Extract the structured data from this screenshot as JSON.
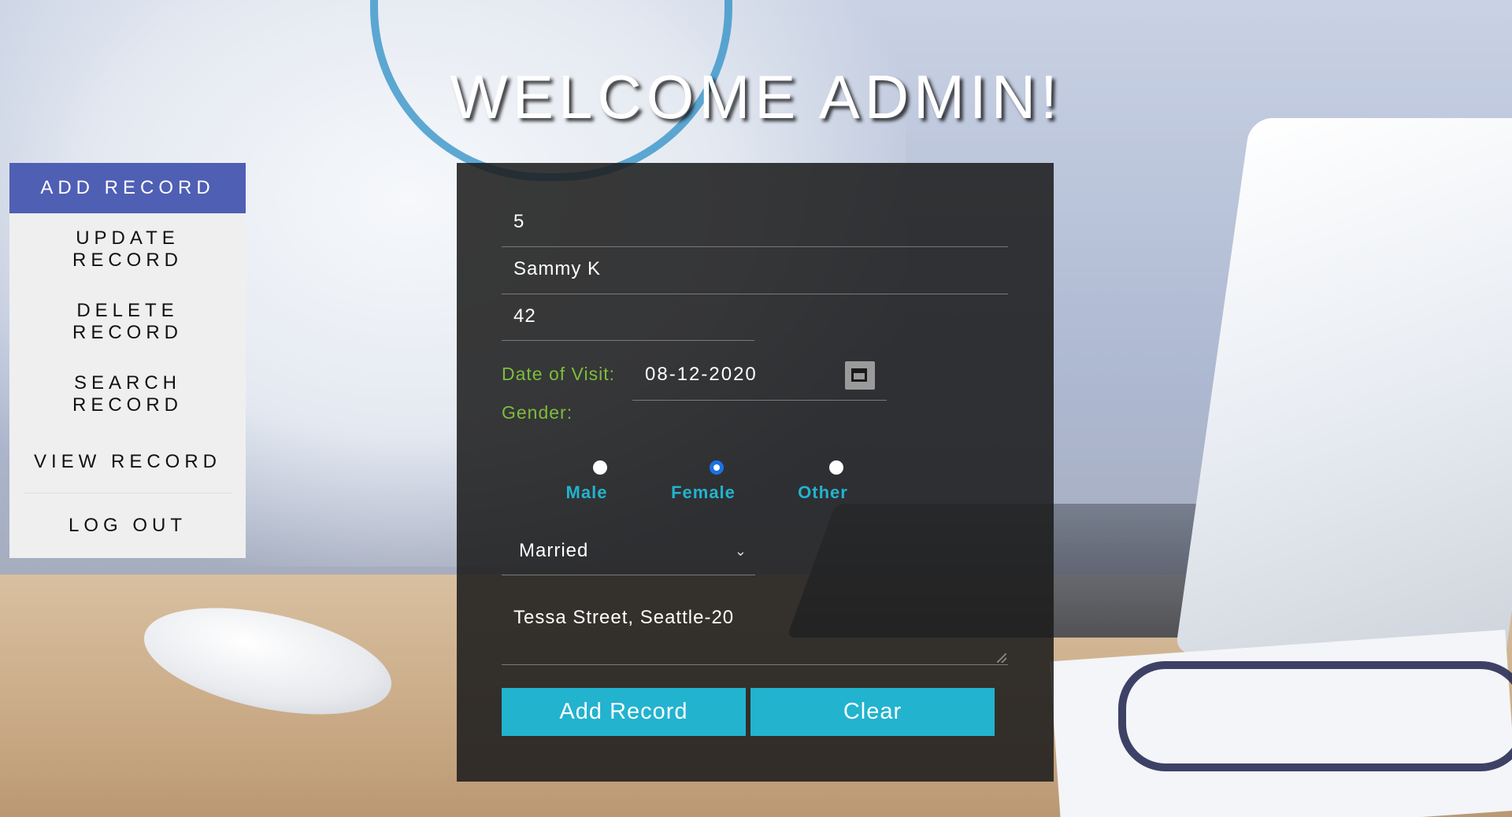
{
  "header": {
    "title": "WELCOME ADMIN!"
  },
  "sidebar": {
    "items": [
      {
        "label": "ADD RECORD",
        "active": true
      },
      {
        "label": "UPDATE RECORD",
        "active": false
      },
      {
        "label": "DELETE RECORD",
        "active": false
      },
      {
        "label": "SEARCH RECORD",
        "active": false
      },
      {
        "label": "VIEW RECORD",
        "active": false
      },
      {
        "label": "LOG OUT",
        "active": false
      }
    ]
  },
  "form": {
    "id_value": "5",
    "name_value": "Sammy K",
    "age_value": "42",
    "date_label": "Date of Visit:",
    "date_value": "08-12-2020",
    "gender_label": "Gender:",
    "gender_options": [
      "Male",
      "Female",
      "Other"
    ],
    "gender_selected": "Female",
    "marital_status_value": "Married",
    "address_value": "Tessa Street, Seattle-20",
    "add_button": "Add Record",
    "clear_button": "Clear"
  },
  "colors": {
    "sidebar_active": "#4f5fb4",
    "button": "#22b3cf",
    "label_green": "#7cbe3a",
    "radio_label": "#22b3cf"
  },
  "icons": {
    "date_picker": "calendar-icon",
    "select_arrow": "chevron-down-icon"
  }
}
